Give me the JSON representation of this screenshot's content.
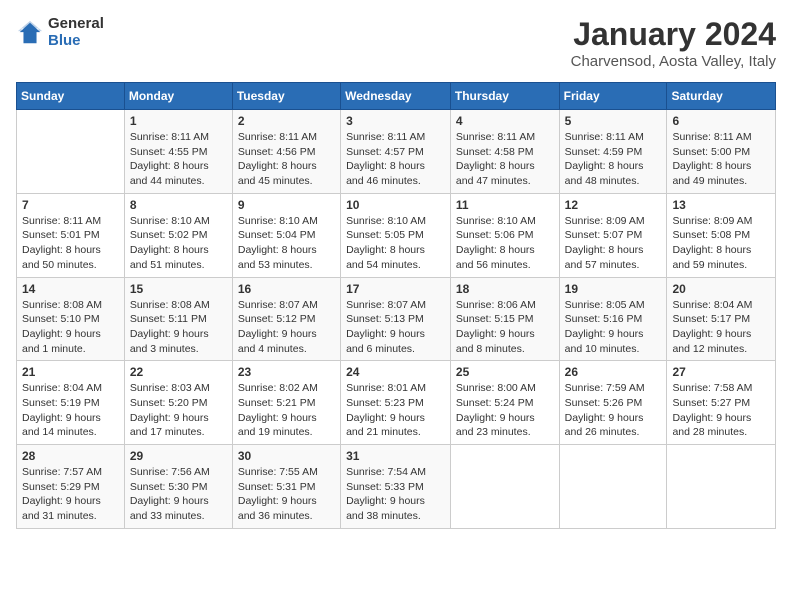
{
  "logo": {
    "general": "General",
    "blue": "Blue"
  },
  "title": "January 2024",
  "location": "Charvensod, Aosta Valley, Italy",
  "days_of_week": [
    "Sunday",
    "Monday",
    "Tuesday",
    "Wednesday",
    "Thursday",
    "Friday",
    "Saturday"
  ],
  "weeks": [
    [
      {
        "day": "",
        "sunrise": "",
        "sunset": "",
        "daylight": ""
      },
      {
        "day": "1",
        "sunrise": "Sunrise: 8:11 AM",
        "sunset": "Sunset: 4:55 PM",
        "daylight": "Daylight: 8 hours and 44 minutes."
      },
      {
        "day": "2",
        "sunrise": "Sunrise: 8:11 AM",
        "sunset": "Sunset: 4:56 PM",
        "daylight": "Daylight: 8 hours and 45 minutes."
      },
      {
        "day": "3",
        "sunrise": "Sunrise: 8:11 AM",
        "sunset": "Sunset: 4:57 PM",
        "daylight": "Daylight: 8 hours and 46 minutes."
      },
      {
        "day": "4",
        "sunrise": "Sunrise: 8:11 AM",
        "sunset": "Sunset: 4:58 PM",
        "daylight": "Daylight: 8 hours and 47 minutes."
      },
      {
        "day": "5",
        "sunrise": "Sunrise: 8:11 AM",
        "sunset": "Sunset: 4:59 PM",
        "daylight": "Daylight: 8 hours and 48 minutes."
      },
      {
        "day": "6",
        "sunrise": "Sunrise: 8:11 AM",
        "sunset": "Sunset: 5:00 PM",
        "daylight": "Daylight: 8 hours and 49 minutes."
      }
    ],
    [
      {
        "day": "7",
        "sunrise": "Sunrise: 8:11 AM",
        "sunset": "Sunset: 5:01 PM",
        "daylight": "Daylight: 8 hours and 50 minutes."
      },
      {
        "day": "8",
        "sunrise": "Sunrise: 8:10 AM",
        "sunset": "Sunset: 5:02 PM",
        "daylight": "Daylight: 8 hours and 51 minutes."
      },
      {
        "day": "9",
        "sunrise": "Sunrise: 8:10 AM",
        "sunset": "Sunset: 5:04 PM",
        "daylight": "Daylight: 8 hours and 53 minutes."
      },
      {
        "day": "10",
        "sunrise": "Sunrise: 8:10 AM",
        "sunset": "Sunset: 5:05 PM",
        "daylight": "Daylight: 8 hours and 54 minutes."
      },
      {
        "day": "11",
        "sunrise": "Sunrise: 8:10 AM",
        "sunset": "Sunset: 5:06 PM",
        "daylight": "Daylight: 8 hours and 56 minutes."
      },
      {
        "day": "12",
        "sunrise": "Sunrise: 8:09 AM",
        "sunset": "Sunset: 5:07 PM",
        "daylight": "Daylight: 8 hours and 57 minutes."
      },
      {
        "day": "13",
        "sunrise": "Sunrise: 8:09 AM",
        "sunset": "Sunset: 5:08 PM",
        "daylight": "Daylight: 8 hours and 59 minutes."
      }
    ],
    [
      {
        "day": "14",
        "sunrise": "Sunrise: 8:08 AM",
        "sunset": "Sunset: 5:10 PM",
        "daylight": "Daylight: 9 hours and 1 minute."
      },
      {
        "day": "15",
        "sunrise": "Sunrise: 8:08 AM",
        "sunset": "Sunset: 5:11 PM",
        "daylight": "Daylight: 9 hours and 3 minutes."
      },
      {
        "day": "16",
        "sunrise": "Sunrise: 8:07 AM",
        "sunset": "Sunset: 5:12 PM",
        "daylight": "Daylight: 9 hours and 4 minutes."
      },
      {
        "day": "17",
        "sunrise": "Sunrise: 8:07 AM",
        "sunset": "Sunset: 5:13 PM",
        "daylight": "Daylight: 9 hours and 6 minutes."
      },
      {
        "day": "18",
        "sunrise": "Sunrise: 8:06 AM",
        "sunset": "Sunset: 5:15 PM",
        "daylight": "Daylight: 9 hours and 8 minutes."
      },
      {
        "day": "19",
        "sunrise": "Sunrise: 8:05 AM",
        "sunset": "Sunset: 5:16 PM",
        "daylight": "Daylight: 9 hours and 10 minutes."
      },
      {
        "day": "20",
        "sunrise": "Sunrise: 8:04 AM",
        "sunset": "Sunset: 5:17 PM",
        "daylight": "Daylight: 9 hours and 12 minutes."
      }
    ],
    [
      {
        "day": "21",
        "sunrise": "Sunrise: 8:04 AM",
        "sunset": "Sunset: 5:19 PM",
        "daylight": "Daylight: 9 hours and 14 minutes."
      },
      {
        "day": "22",
        "sunrise": "Sunrise: 8:03 AM",
        "sunset": "Sunset: 5:20 PM",
        "daylight": "Daylight: 9 hours and 17 minutes."
      },
      {
        "day": "23",
        "sunrise": "Sunrise: 8:02 AM",
        "sunset": "Sunset: 5:21 PM",
        "daylight": "Daylight: 9 hours and 19 minutes."
      },
      {
        "day": "24",
        "sunrise": "Sunrise: 8:01 AM",
        "sunset": "Sunset: 5:23 PM",
        "daylight": "Daylight: 9 hours and 21 minutes."
      },
      {
        "day": "25",
        "sunrise": "Sunrise: 8:00 AM",
        "sunset": "Sunset: 5:24 PM",
        "daylight": "Daylight: 9 hours and 23 minutes."
      },
      {
        "day": "26",
        "sunrise": "Sunrise: 7:59 AM",
        "sunset": "Sunset: 5:26 PM",
        "daylight": "Daylight: 9 hours and 26 minutes."
      },
      {
        "day": "27",
        "sunrise": "Sunrise: 7:58 AM",
        "sunset": "Sunset: 5:27 PM",
        "daylight": "Daylight: 9 hours and 28 minutes."
      }
    ],
    [
      {
        "day": "28",
        "sunrise": "Sunrise: 7:57 AM",
        "sunset": "Sunset: 5:29 PM",
        "daylight": "Daylight: 9 hours and 31 minutes."
      },
      {
        "day": "29",
        "sunrise": "Sunrise: 7:56 AM",
        "sunset": "Sunset: 5:30 PM",
        "daylight": "Daylight: 9 hours and 33 minutes."
      },
      {
        "day": "30",
        "sunrise": "Sunrise: 7:55 AM",
        "sunset": "Sunset: 5:31 PM",
        "daylight": "Daylight: 9 hours and 36 minutes."
      },
      {
        "day": "31",
        "sunrise": "Sunrise: 7:54 AM",
        "sunset": "Sunset: 5:33 PM",
        "daylight": "Daylight: 9 hours and 38 minutes."
      },
      {
        "day": "",
        "sunrise": "",
        "sunset": "",
        "daylight": ""
      },
      {
        "day": "",
        "sunrise": "",
        "sunset": "",
        "daylight": ""
      },
      {
        "day": "",
        "sunrise": "",
        "sunset": "",
        "daylight": ""
      }
    ]
  ]
}
